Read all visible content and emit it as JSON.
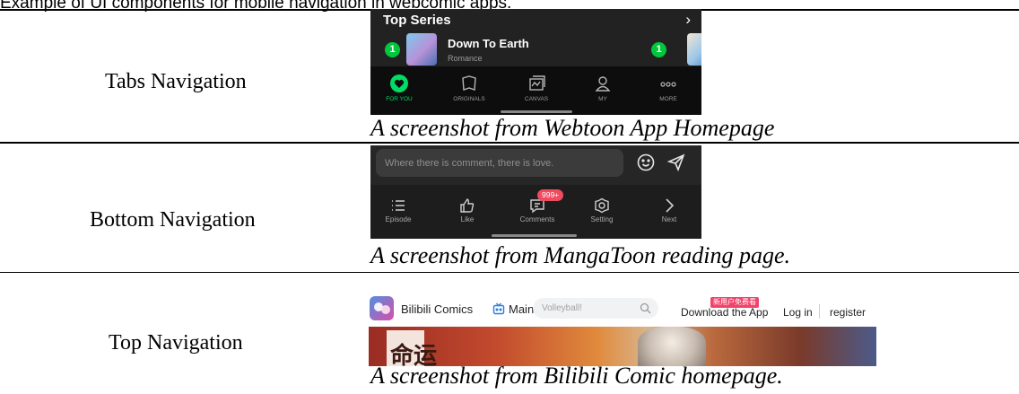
{
  "header_fragment": "Example of UI components for mobile navigation in webcomic apps.",
  "rows": [
    {
      "label": "Tabs Navigation",
      "caption": "A screenshot from Webtoon App Homepage"
    },
    {
      "label": "Bottom Navigation",
      "caption": "A screenshot from MangaToon reading page."
    },
    {
      "label": "Top Navigation",
      "caption": "A screenshot from Bilibili Comic homepage."
    }
  ],
  "webtoon": {
    "section_title": "Top Series",
    "rank_badge": "1",
    "series_title": "Down To Earth",
    "series_genre": "Romance",
    "tabs": [
      {
        "label": "FOR YOU",
        "icon": "heart-circle-icon",
        "active": true
      },
      {
        "label": "ORIGINALS",
        "icon": "book-icon",
        "active": false
      },
      {
        "label": "CANVAS",
        "icon": "canvas-icon",
        "active": false
      },
      {
        "label": "MY",
        "icon": "user-icon",
        "active": false
      },
      {
        "label": "MORE",
        "icon": "more-dots-icon",
        "active": false
      }
    ],
    "accent_color": "#00dc64"
  },
  "mangatoon": {
    "comment_placeholder": "Where there is comment, there is love.",
    "comment_count": "999+",
    "items": [
      {
        "label": "Episode",
        "icon": "list-icon"
      },
      {
        "label": "Like",
        "icon": "thumbs-up-icon"
      },
      {
        "label": "Comments",
        "icon": "comment-icon"
      },
      {
        "label": "Setting",
        "icon": "gear-icon"
      },
      {
        "label": "Next",
        "icon": "chevron-right-icon"
      }
    ],
    "badge_color": "#f04b5f"
  },
  "bilibili": {
    "brand": "Bilibili Comics",
    "main_tab": "Main s",
    "search_placeholder": "Volleyball!",
    "promo_tag": "新用户免费看",
    "download": "Download the App",
    "login": "Log in",
    "register": "register",
    "banner_text": "命运"
  }
}
